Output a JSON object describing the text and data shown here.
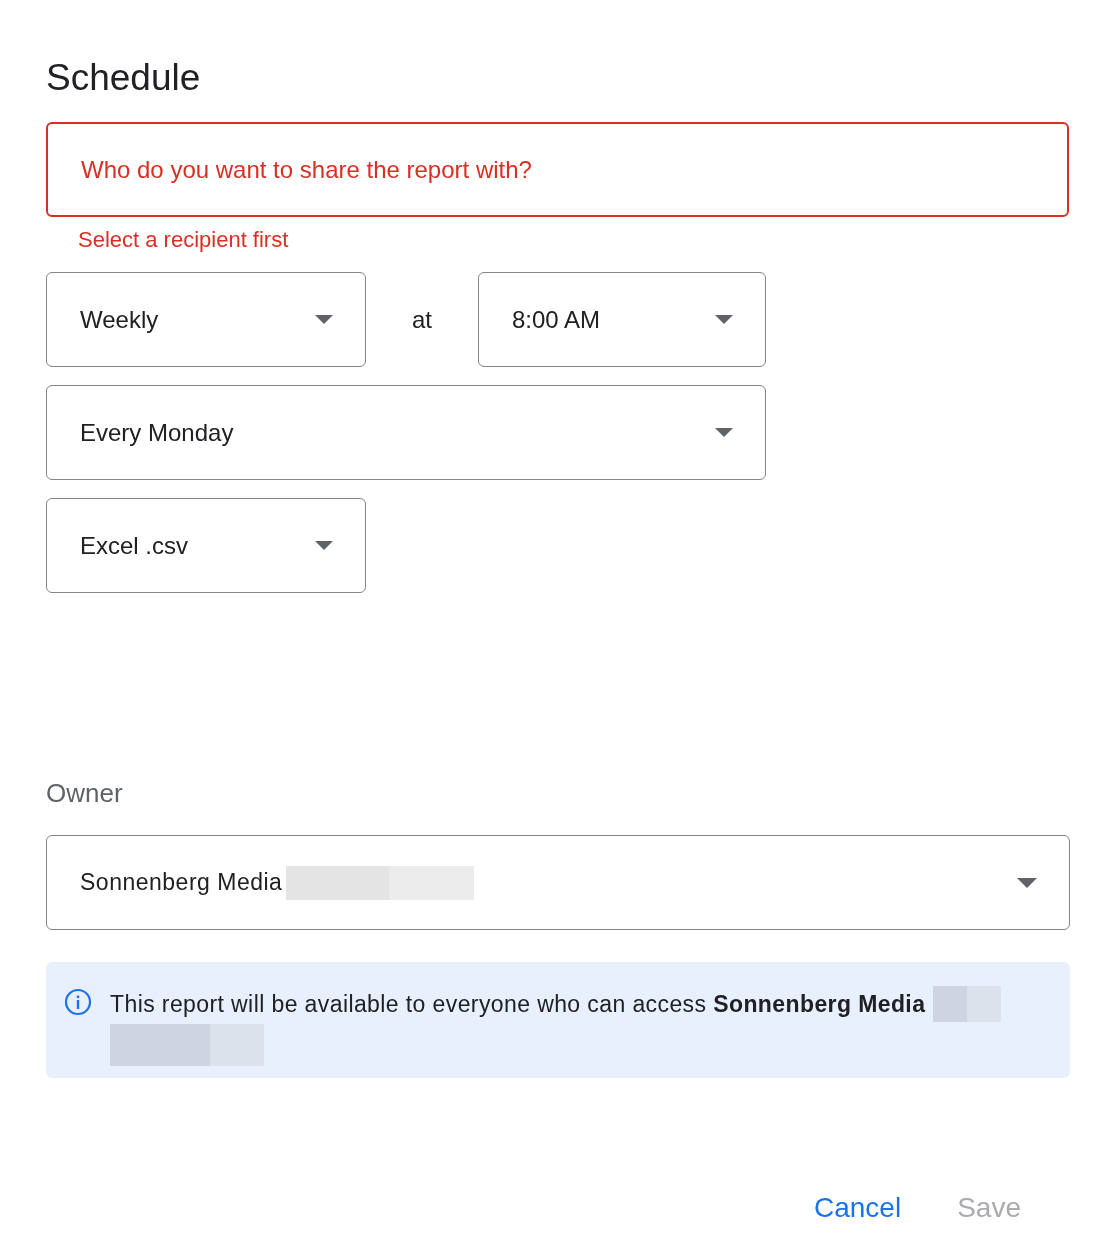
{
  "title": "Schedule",
  "recipients": {
    "placeholder": "Who do you want to share the report with?",
    "error": true,
    "helper": "Select a recipient first"
  },
  "frequency": {
    "value": "Weekly"
  },
  "connector": "at",
  "time": {
    "value": "8:00 AM"
  },
  "day": {
    "value": "Every Monday"
  },
  "format": {
    "value": "Excel .csv"
  },
  "owner": {
    "label": "Owner",
    "value": "Sonnenberg Media"
  },
  "info": {
    "text": "This report will be available to everyone who can access **Sonnenberg Media**"
  },
  "buttons": [
    {
      "label": "Cancel",
      "disabled": false
    },
    {
      "label": "Save",
      "disabled": true
    }
  ]
}
